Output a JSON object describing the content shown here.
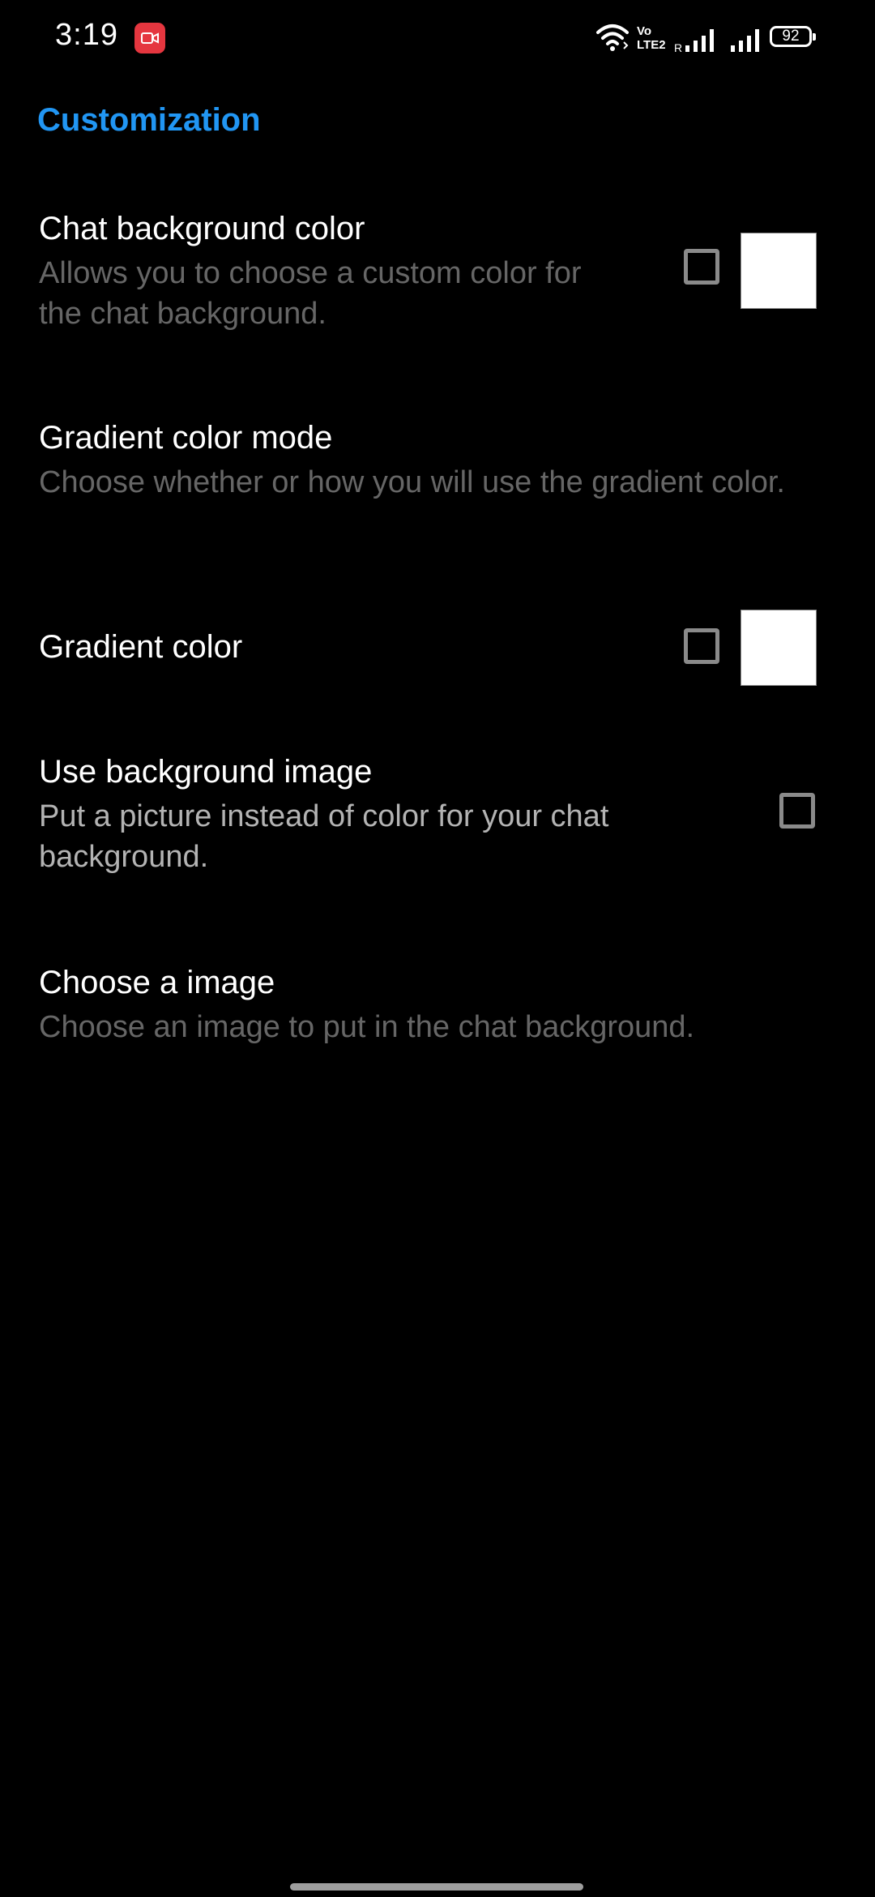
{
  "status_bar": {
    "time": "3:19",
    "battery": "92",
    "volte_line1": "Vo",
    "volte_line2": "LTE2",
    "roaming": "R"
  },
  "section": {
    "title": "Customization",
    "accent_color": "#2196f3"
  },
  "prefs": {
    "chat_bg_color": {
      "title": "Chat background color",
      "summary": "Allows you to choose a custom color for the chat background.",
      "checked": false,
      "swatch_color": "#ffffff"
    },
    "gradient_mode": {
      "title": "Gradient color mode",
      "summary": "Choose whether or how you will use the gradient color."
    },
    "gradient_color": {
      "title": "Gradient color",
      "checked": false,
      "swatch_color": "#ffffff"
    },
    "use_bg_image": {
      "title": "Use background image",
      "summary": "Put a picture instead of color for your chat background.",
      "checked": false
    },
    "choose_image": {
      "title": "Choose a image",
      "summary": "Choose an image to put in the chat background."
    }
  },
  "icons": {
    "wifi": "wifi-icon",
    "signal": "signal-icon",
    "battery": "battery-icon",
    "screen_record": "screen-record-icon"
  }
}
